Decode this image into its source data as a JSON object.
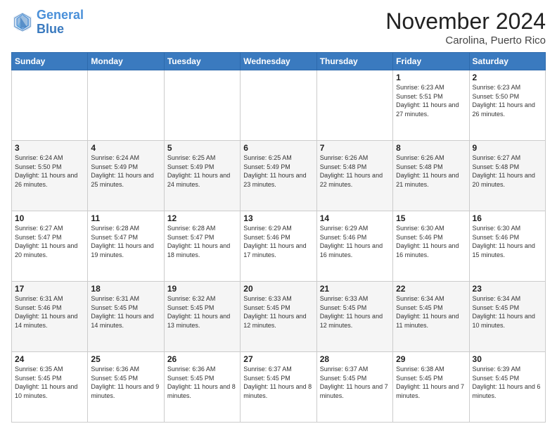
{
  "logo": {
    "line1": "General",
    "line2": "Blue"
  },
  "title": "November 2024",
  "subtitle": "Carolina, Puerto Rico",
  "headers": [
    "Sunday",
    "Monday",
    "Tuesday",
    "Wednesday",
    "Thursday",
    "Friday",
    "Saturday"
  ],
  "weeks": [
    [
      {
        "day": "",
        "info": ""
      },
      {
        "day": "",
        "info": ""
      },
      {
        "day": "",
        "info": ""
      },
      {
        "day": "",
        "info": ""
      },
      {
        "day": "",
        "info": ""
      },
      {
        "day": "1",
        "info": "Sunrise: 6:23 AM\nSunset: 5:51 PM\nDaylight: 11 hours and 27 minutes."
      },
      {
        "day": "2",
        "info": "Sunrise: 6:23 AM\nSunset: 5:50 PM\nDaylight: 11 hours and 26 minutes."
      }
    ],
    [
      {
        "day": "3",
        "info": "Sunrise: 6:24 AM\nSunset: 5:50 PM\nDaylight: 11 hours and 26 minutes."
      },
      {
        "day": "4",
        "info": "Sunrise: 6:24 AM\nSunset: 5:49 PM\nDaylight: 11 hours and 25 minutes."
      },
      {
        "day": "5",
        "info": "Sunrise: 6:25 AM\nSunset: 5:49 PM\nDaylight: 11 hours and 24 minutes."
      },
      {
        "day": "6",
        "info": "Sunrise: 6:25 AM\nSunset: 5:49 PM\nDaylight: 11 hours and 23 minutes."
      },
      {
        "day": "7",
        "info": "Sunrise: 6:26 AM\nSunset: 5:48 PM\nDaylight: 11 hours and 22 minutes."
      },
      {
        "day": "8",
        "info": "Sunrise: 6:26 AM\nSunset: 5:48 PM\nDaylight: 11 hours and 21 minutes."
      },
      {
        "day": "9",
        "info": "Sunrise: 6:27 AM\nSunset: 5:48 PM\nDaylight: 11 hours and 20 minutes."
      }
    ],
    [
      {
        "day": "10",
        "info": "Sunrise: 6:27 AM\nSunset: 5:47 PM\nDaylight: 11 hours and 20 minutes."
      },
      {
        "day": "11",
        "info": "Sunrise: 6:28 AM\nSunset: 5:47 PM\nDaylight: 11 hours and 19 minutes."
      },
      {
        "day": "12",
        "info": "Sunrise: 6:28 AM\nSunset: 5:47 PM\nDaylight: 11 hours and 18 minutes."
      },
      {
        "day": "13",
        "info": "Sunrise: 6:29 AM\nSunset: 5:46 PM\nDaylight: 11 hours and 17 minutes."
      },
      {
        "day": "14",
        "info": "Sunrise: 6:29 AM\nSunset: 5:46 PM\nDaylight: 11 hours and 16 minutes."
      },
      {
        "day": "15",
        "info": "Sunrise: 6:30 AM\nSunset: 5:46 PM\nDaylight: 11 hours and 16 minutes."
      },
      {
        "day": "16",
        "info": "Sunrise: 6:30 AM\nSunset: 5:46 PM\nDaylight: 11 hours and 15 minutes."
      }
    ],
    [
      {
        "day": "17",
        "info": "Sunrise: 6:31 AM\nSunset: 5:46 PM\nDaylight: 11 hours and 14 minutes."
      },
      {
        "day": "18",
        "info": "Sunrise: 6:31 AM\nSunset: 5:45 PM\nDaylight: 11 hours and 14 minutes."
      },
      {
        "day": "19",
        "info": "Sunrise: 6:32 AM\nSunset: 5:45 PM\nDaylight: 11 hours and 13 minutes."
      },
      {
        "day": "20",
        "info": "Sunrise: 6:33 AM\nSunset: 5:45 PM\nDaylight: 11 hours and 12 minutes."
      },
      {
        "day": "21",
        "info": "Sunrise: 6:33 AM\nSunset: 5:45 PM\nDaylight: 11 hours and 12 minutes."
      },
      {
        "day": "22",
        "info": "Sunrise: 6:34 AM\nSunset: 5:45 PM\nDaylight: 11 hours and 11 minutes."
      },
      {
        "day": "23",
        "info": "Sunrise: 6:34 AM\nSunset: 5:45 PM\nDaylight: 11 hours and 10 minutes."
      }
    ],
    [
      {
        "day": "24",
        "info": "Sunrise: 6:35 AM\nSunset: 5:45 PM\nDaylight: 11 hours and 10 minutes."
      },
      {
        "day": "25",
        "info": "Sunrise: 6:36 AM\nSunset: 5:45 PM\nDaylight: 11 hours and 9 minutes."
      },
      {
        "day": "26",
        "info": "Sunrise: 6:36 AM\nSunset: 5:45 PM\nDaylight: 11 hours and 8 minutes."
      },
      {
        "day": "27",
        "info": "Sunrise: 6:37 AM\nSunset: 5:45 PM\nDaylight: 11 hours and 8 minutes."
      },
      {
        "day": "28",
        "info": "Sunrise: 6:37 AM\nSunset: 5:45 PM\nDaylight: 11 hours and 7 minutes."
      },
      {
        "day": "29",
        "info": "Sunrise: 6:38 AM\nSunset: 5:45 PM\nDaylight: 11 hours and 7 minutes."
      },
      {
        "day": "30",
        "info": "Sunrise: 6:39 AM\nSunset: 5:45 PM\nDaylight: 11 hours and 6 minutes."
      }
    ]
  ]
}
